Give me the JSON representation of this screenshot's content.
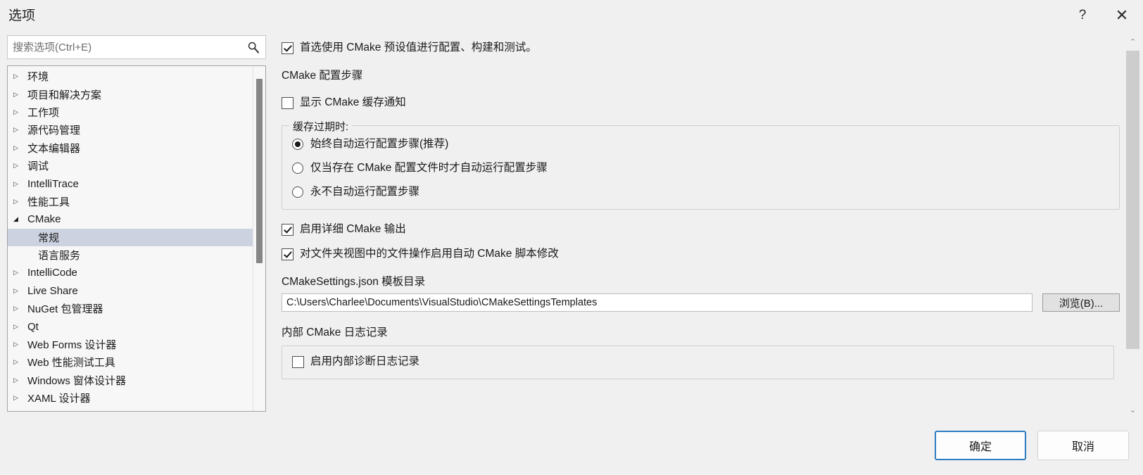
{
  "window": {
    "title": "选项",
    "help_label": "?",
    "close_label": "✕"
  },
  "search": {
    "placeholder": "搜索选项(Ctrl+E)",
    "value": "",
    "icon": "search-icon"
  },
  "tree": {
    "items": [
      {
        "label": "环境",
        "arrow": "▷",
        "expanded": false,
        "child": false,
        "selected": false
      },
      {
        "label": "项目和解决方案",
        "arrow": "▷",
        "expanded": false,
        "child": false,
        "selected": false
      },
      {
        "label": "工作项",
        "arrow": "▷",
        "expanded": false,
        "child": false,
        "selected": false
      },
      {
        "label": "源代码管理",
        "arrow": "▷",
        "expanded": false,
        "child": false,
        "selected": false
      },
      {
        "label": "文本编辑器",
        "arrow": "▷",
        "expanded": false,
        "child": false,
        "selected": false
      },
      {
        "label": "调试",
        "arrow": "▷",
        "expanded": false,
        "child": false,
        "selected": false
      },
      {
        "label": "IntelliTrace",
        "arrow": "▷",
        "expanded": false,
        "child": false,
        "selected": false
      },
      {
        "label": "性能工具",
        "arrow": "▷",
        "expanded": false,
        "child": false,
        "selected": false
      },
      {
        "label": "CMake",
        "arrow": "◢",
        "expanded": true,
        "child": false,
        "selected": false
      },
      {
        "label": "常规",
        "arrow": "",
        "expanded": false,
        "child": true,
        "selected": true
      },
      {
        "label": "语言服务",
        "arrow": "",
        "expanded": false,
        "child": true,
        "selected": false
      },
      {
        "label": "IntelliCode",
        "arrow": "▷",
        "expanded": false,
        "child": false,
        "selected": false
      },
      {
        "label": "Live Share",
        "arrow": "▷",
        "expanded": false,
        "child": false,
        "selected": false
      },
      {
        "label": "NuGet 包管理器",
        "arrow": "▷",
        "expanded": false,
        "child": false,
        "selected": false
      },
      {
        "label": "Qt",
        "arrow": "▷",
        "expanded": false,
        "child": false,
        "selected": false
      },
      {
        "label": "Web Forms 设计器",
        "arrow": "▷",
        "expanded": false,
        "child": false,
        "selected": false
      },
      {
        "label": "Web 性能测试工具",
        "arrow": "▷",
        "expanded": false,
        "child": false,
        "selected": false
      },
      {
        "label": "Windows 窗体设计器",
        "arrow": "▷",
        "expanded": false,
        "child": false,
        "selected": false
      },
      {
        "label": "XAML 设计器",
        "arrow": "▷",
        "expanded": false,
        "child": false,
        "selected": false
      }
    ]
  },
  "main": {
    "prefer_presets_checkbox": {
      "label": "首选使用 CMake 预设值进行配置、构建和测试。",
      "checked": true
    },
    "configure_step_heading": "CMake 配置步骤",
    "show_cache_notification_checkbox": {
      "label": "显示 CMake 缓存通知",
      "checked": false
    },
    "cache_expired_group": {
      "title": "缓存过期时:",
      "options": [
        {
          "label": "始终自动运行配置步骤(推荐)",
          "selected": true
        },
        {
          "label": "仅当存在 CMake 配置文件时才自动运行配置步骤",
          "selected": false
        },
        {
          "label": "永不自动运行配置步骤",
          "selected": false
        }
      ]
    },
    "verbose_output_checkbox": {
      "label": "启用详细 CMake 输出",
      "checked": true
    },
    "auto_script_modification_checkbox": {
      "label": "对文件夹视图中的文件操作启用自动 CMake 脚本修改",
      "checked": true
    },
    "template_dir_label": "CMakeSettings.json 模板目录",
    "template_dir_value": "C:\\Users\\Charlee\\Documents\\VisualStudio\\CMakeSettingsTemplates",
    "browse_button_label": "浏览(B)...",
    "internal_logging_heading": "内部 CMake 日志记录",
    "internal_diagnostic_checkbox": {
      "label": "启用内部诊断日志记录",
      "checked": false
    },
    "scroll_up_label": "⌃",
    "scroll_down_label": "⌄"
  },
  "footer": {
    "ok_label": "确定",
    "cancel_label": "取消"
  },
  "colors": {
    "dialog_bg": "#f0f0f0",
    "selection": "#cdd2e0",
    "accent": "#2d7cc0",
    "text": "#1a1a1a"
  }
}
